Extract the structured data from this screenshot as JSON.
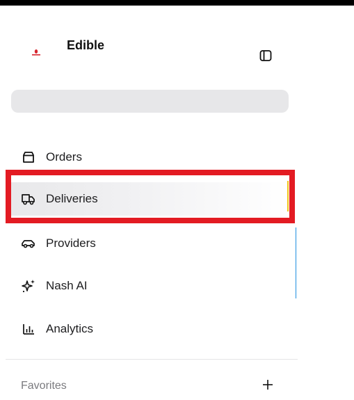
{
  "brand": {
    "name": "Edible",
    "logo_icon": "edible-logo-icon",
    "logo_color": "#d7262f"
  },
  "sidebar": {
    "collapse_icon": "panel-left-icon",
    "search": {
      "placeholder": ""
    },
    "items": [
      {
        "label": "Orders",
        "icon": "package-icon",
        "active": false
      },
      {
        "label": "Deliveries",
        "icon": "truck-icon",
        "active": true
      },
      {
        "label": "Providers",
        "icon": "car-icon",
        "active": false
      },
      {
        "label": "Nash AI",
        "icon": "sparkles-icon",
        "active": false
      },
      {
        "label": "Analytics",
        "icon": "bar-chart-icon",
        "active": false
      }
    ],
    "favorites": {
      "label": "Favorites",
      "add_icon": "plus-icon"
    }
  },
  "colors": {
    "highlight_border": "#e31b23",
    "active_bg": "#e8e8ea",
    "search_bg": "#e7e7e9",
    "muted_text": "#7a7a7e"
  }
}
